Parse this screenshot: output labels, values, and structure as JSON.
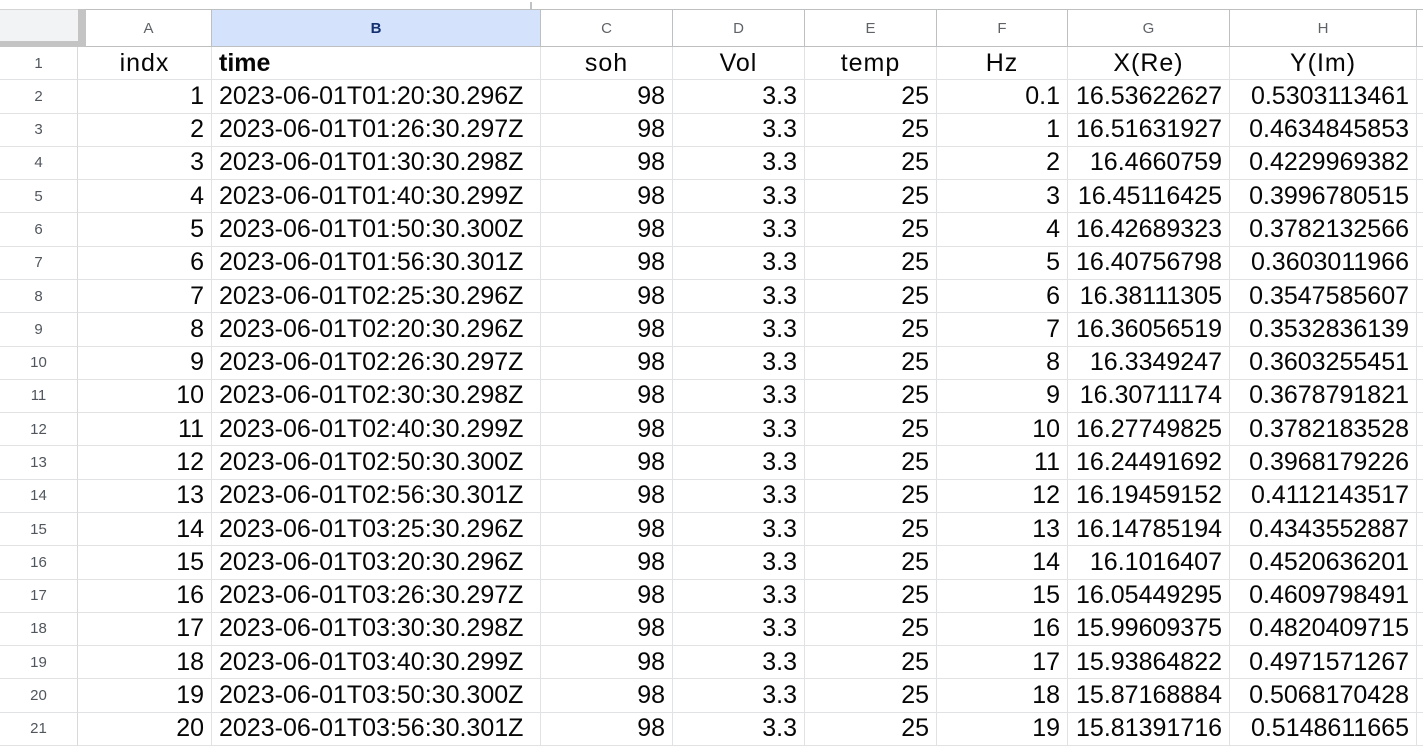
{
  "sheet": {
    "selected_column": "B",
    "column_headers": [
      "A",
      "B",
      "C",
      "D",
      "E",
      "F",
      "G",
      "H"
    ],
    "row_numbers": [
      1,
      2,
      3,
      4,
      5,
      6,
      7,
      8,
      9,
      10,
      11,
      12,
      13,
      14,
      15,
      16,
      17,
      18,
      19,
      20,
      21
    ],
    "field_headers": [
      "indx",
      "time",
      "soh",
      "Vol",
      "temp",
      "Hz",
      "X(Re)",
      "Y(Im)"
    ],
    "rows": [
      [
        "1",
        "2023-06-01T01:20:30.296Z",
        "98",
        "3.3",
        "25",
        "0.1",
        "16.53622627",
        "0.5303113461"
      ],
      [
        "2",
        "2023-06-01T01:26:30.297Z",
        "98",
        "3.3",
        "25",
        "1",
        "16.51631927",
        "0.4634845853"
      ],
      [
        "3",
        "2023-06-01T01:30:30.298Z",
        "98",
        "3.3",
        "25",
        "2",
        "16.4660759",
        "0.4229969382"
      ],
      [
        "4",
        "2023-06-01T01:40:30.299Z",
        "98",
        "3.3",
        "25",
        "3",
        "16.45116425",
        "0.3996780515"
      ],
      [
        "5",
        "2023-06-01T01:50:30.300Z",
        "98",
        "3.3",
        "25",
        "4",
        "16.42689323",
        "0.3782132566"
      ],
      [
        "6",
        "2023-06-01T01:56:30.301Z",
        "98",
        "3.3",
        "25",
        "5",
        "16.40756798",
        "0.3603011966"
      ],
      [
        "7",
        "2023-06-01T02:25:30.296Z",
        "98",
        "3.3",
        "25",
        "6",
        "16.38111305",
        "0.3547585607"
      ],
      [
        "8",
        "2023-06-01T02:20:30.296Z",
        "98",
        "3.3",
        "25",
        "7",
        "16.36056519",
        "0.3532836139"
      ],
      [
        "9",
        "2023-06-01T02:26:30.297Z",
        "98",
        "3.3",
        "25",
        "8",
        "16.3349247",
        "0.3603255451"
      ],
      [
        "10",
        "2023-06-01T02:30:30.298Z",
        "98",
        "3.3",
        "25",
        "9",
        "16.30711174",
        "0.3678791821"
      ],
      [
        "11",
        "2023-06-01T02:40:30.299Z",
        "98",
        "3.3",
        "25",
        "10",
        "16.27749825",
        "0.3782183528"
      ],
      [
        "12",
        "2023-06-01T02:50:30.300Z",
        "98",
        "3.3",
        "25",
        "11",
        "16.24491692",
        "0.3968179226"
      ],
      [
        "13",
        "2023-06-01T02:56:30.301Z",
        "98",
        "3.3",
        "25",
        "12",
        "16.19459152",
        "0.4112143517"
      ],
      [
        "14",
        "2023-06-01T03:25:30.296Z",
        "98",
        "3.3",
        "25",
        "13",
        "16.14785194",
        "0.4343552887"
      ],
      [
        "15",
        "2023-06-01T03:20:30.296Z",
        "98",
        "3.3",
        "25",
        "14",
        "16.1016407",
        "0.4520636201"
      ],
      [
        "16",
        "2023-06-01T03:26:30.297Z",
        "98",
        "3.3",
        "25",
        "15",
        "16.05449295",
        "0.4609798491"
      ],
      [
        "17",
        "2023-06-01T03:30:30.298Z",
        "98",
        "3.3",
        "25",
        "16",
        "15.99609375",
        "0.4820409715"
      ],
      [
        "18",
        "2023-06-01T03:40:30.299Z",
        "98",
        "3.3",
        "25",
        "17",
        "15.93864822",
        "0.4971571267"
      ],
      [
        "19",
        "2023-06-01T03:50:30.300Z",
        "98",
        "3.3",
        "25",
        "18",
        "15.87168884",
        "0.5068170428"
      ],
      [
        "20",
        "2023-06-01T03:56:30.301Z",
        "98",
        "3.3",
        "25",
        "19",
        "15.81391716",
        "0.5148611665"
      ]
    ],
    "colors": {
      "selected_header_bg": "#d5e2fb",
      "selected_header_text": "#14306e",
      "header_text": "#5f6368",
      "gridline": "#e1e2e3",
      "header_border": "#bdbfc1",
      "corner_accent": "#c4c4c4"
    }
  }
}
